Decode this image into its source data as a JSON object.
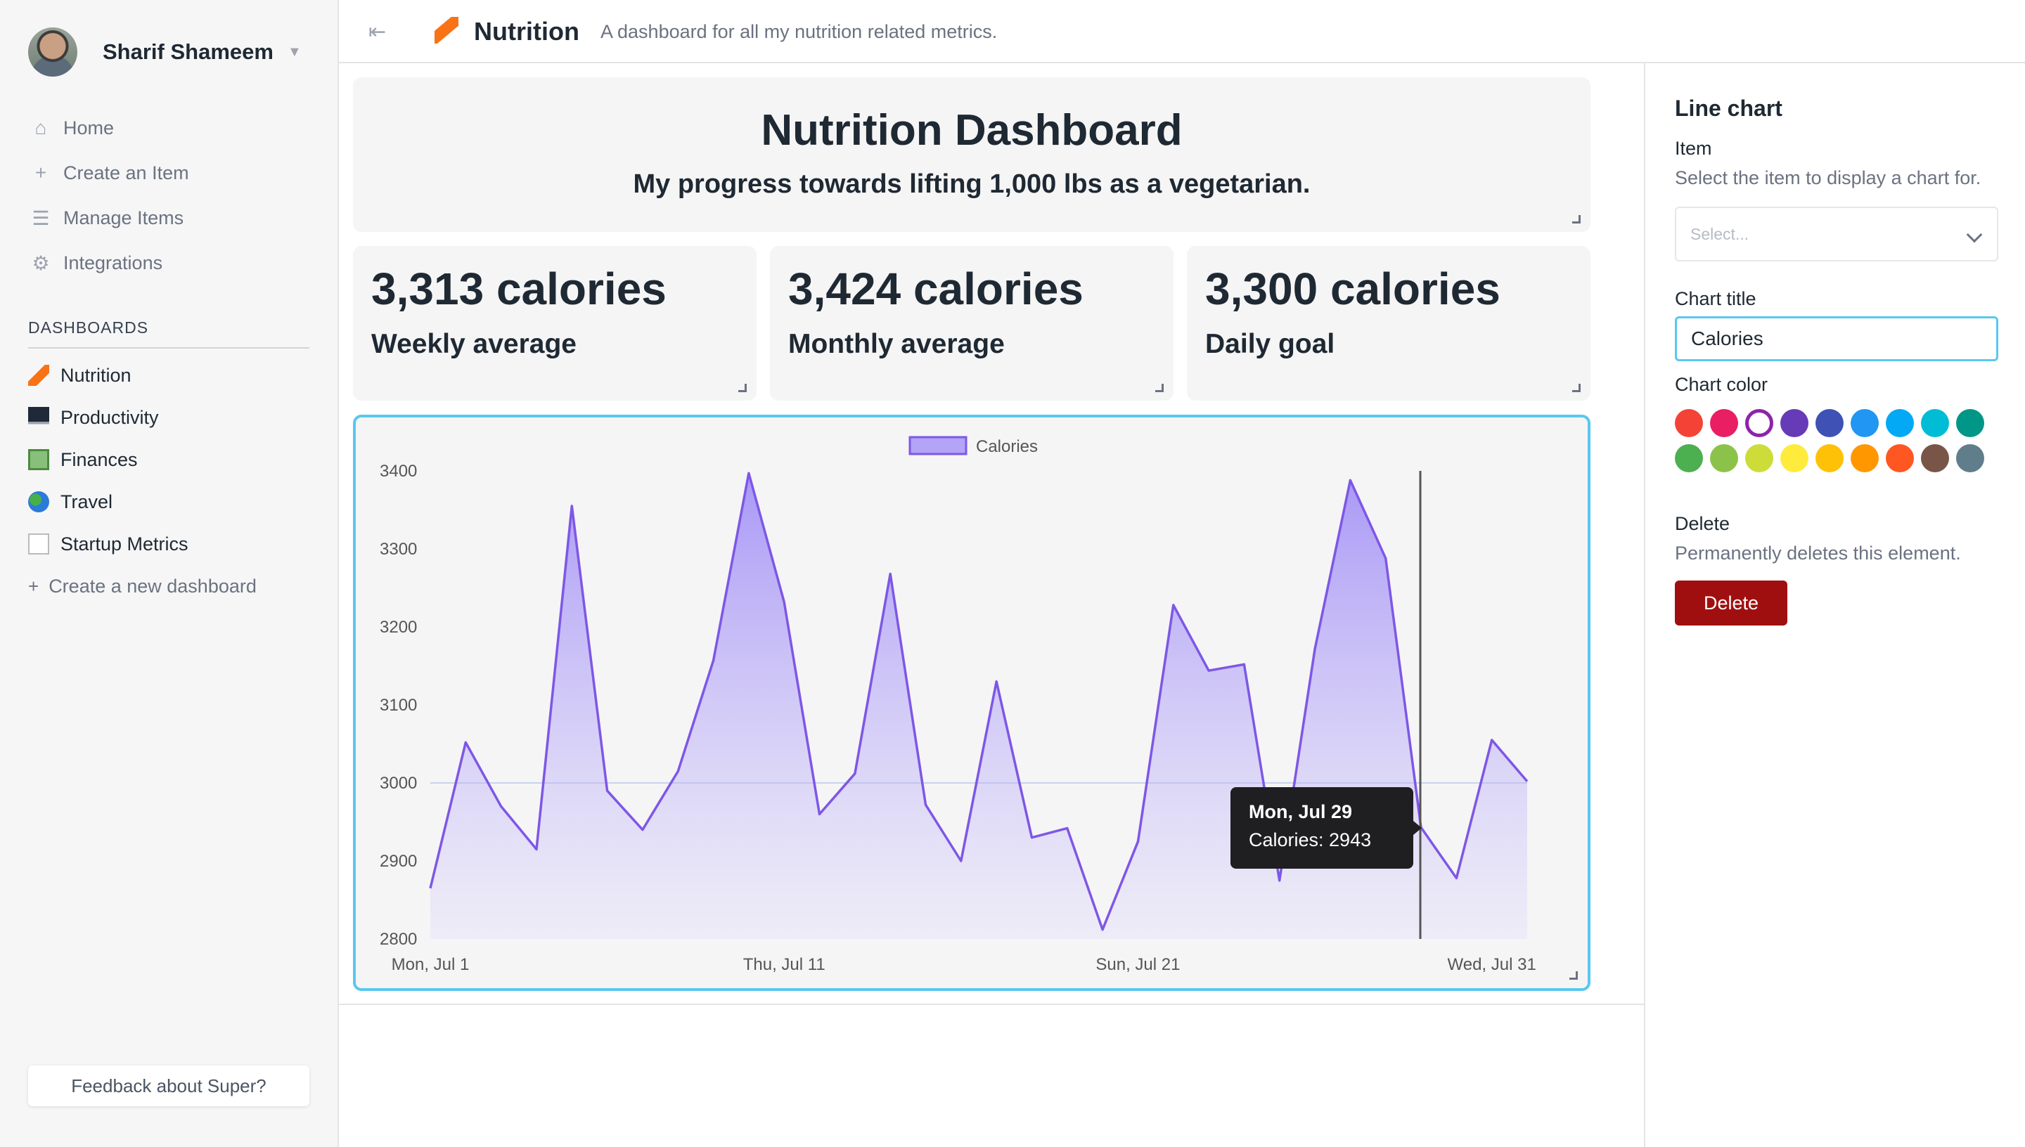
{
  "user": {
    "name": "Sharif Shameem"
  },
  "nav": [
    {
      "label": "Home",
      "icon": "home-icon"
    },
    {
      "label": "Create an Item",
      "icon": "plus-icon"
    },
    {
      "label": "Manage Items",
      "icon": "list-icon"
    },
    {
      "label": "Integrations",
      "icon": "gear-icon"
    }
  ],
  "dashboards_label": "DASHBOARDS",
  "dashboards": [
    {
      "label": "Nutrition",
      "icon": "carrot-icon"
    },
    {
      "label": "Productivity",
      "icon": "laptop-icon"
    },
    {
      "label": "Finances",
      "icon": "money-icon"
    },
    {
      "label": "Travel",
      "icon": "globe-icon"
    },
    {
      "label": "Startup Metrics",
      "icon": "chart-icon"
    }
  ],
  "create_dashboard_label": "Create a new dashboard",
  "feedback_label": "Feedback about Super?",
  "header": {
    "title": "Nutrition",
    "description": "A dashboard for all my nutrition related metrics."
  },
  "title_card": {
    "title": "Nutrition Dashboard",
    "subtitle": "My progress towards lifting 1,000 lbs as a vegetarian."
  },
  "stats": [
    {
      "value": "3,313 calories",
      "label": "Weekly average"
    },
    {
      "value": "3,424 calories",
      "label": "Monthly average"
    },
    {
      "value": "3,300 calories",
      "label": "Daily goal"
    }
  ],
  "chart_data": {
    "type": "area",
    "legend": [
      "Calories"
    ],
    "legend_position": "top-center",
    "x": [
      "Jul 1",
      "Jul 2",
      "Jul 3",
      "Jul 4",
      "Jul 5",
      "Jul 6",
      "Jul 7",
      "Jul 8",
      "Jul 9",
      "Jul 10",
      "Jul 11",
      "Jul 12",
      "Jul 13",
      "Jul 14",
      "Jul 15",
      "Jul 16",
      "Jul 17",
      "Jul 18",
      "Jul 19",
      "Jul 20",
      "Jul 21",
      "Jul 22",
      "Jul 23",
      "Jul 24",
      "Jul 25",
      "Jul 26",
      "Jul 27",
      "Jul 28",
      "Jul 29",
      "Jul 30",
      "Jul 31"
    ],
    "x_tick_labels": [
      "Mon, Jul 1",
      "Thu, Jul 11",
      "Sun, Jul 21",
      "Wed, Jul 31"
    ],
    "series": [
      {
        "name": "Calories",
        "values": [
          2865,
          3052,
          2970,
          2915,
          3355,
          2990,
          2940,
          3015,
          3157,
          3397,
          3232,
          2960,
          3012,
          3268,
          2972,
          2900,
          3130,
          2930,
          2942,
          2812,
          2925,
          3228,
          3144,
          3152,
          2875,
          3172,
          3388,
          3288,
          2943,
          2878,
          3055,
          3002
        ]
      }
    ],
    "ylim": [
      2800,
      3400
    ],
    "y_ticks": [
      "3400",
      "3300",
      "3200",
      "3100",
      "3000",
      "2900",
      "2800"
    ],
    "grid": false,
    "color": "#7e57e6",
    "tooltip": {
      "title": "Mon, Jul 29",
      "body": "Calories: 2943"
    }
  },
  "panel": {
    "title": "Line chart",
    "item_label": "Item",
    "item_help": "Select the item to display a chart for.",
    "select_placeholder": "Select...",
    "chart_title_label": "Chart title",
    "chart_title_value": "Calories",
    "chart_color_label": "Chart color",
    "colors": [
      "#f44336",
      "#e91e63",
      "#9c27b0",
      "#673ab7",
      "#3f51b5",
      "#2196f3",
      "#03a9f4",
      "#00bcd4",
      "#009688",
      "#4caf50",
      "#8bc34a",
      "#cddc39",
      "#ffeb3b",
      "#ffc107",
      "#ff9800",
      "#ff5722",
      "#795548",
      "#607d8b"
    ],
    "selected_color": "#9c27b0",
    "delete_label": "Delete",
    "delete_help": "Permanently deletes this element.",
    "delete_button": "Delete"
  }
}
